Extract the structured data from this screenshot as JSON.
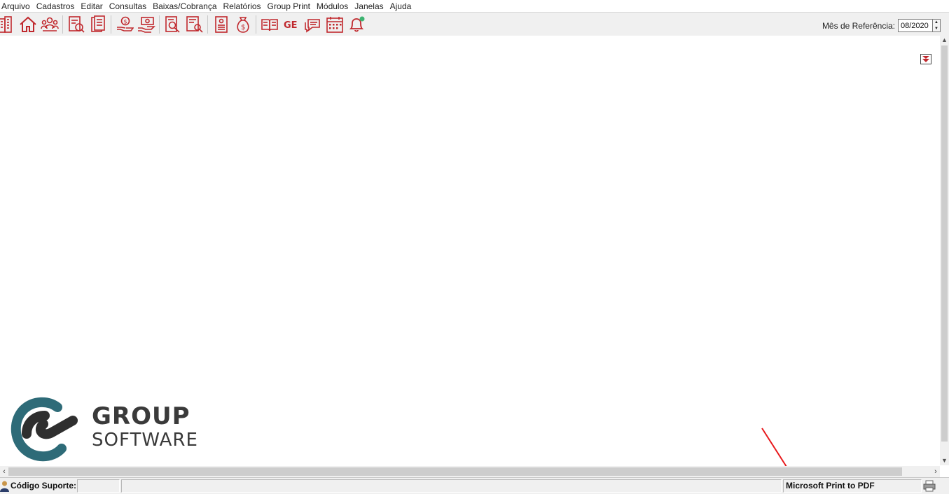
{
  "menu": {
    "items": [
      "Arquivo",
      "Cadastros",
      "Editar",
      "Consultas",
      "Baixas/Cobrança",
      "Relatórios",
      "Group Print",
      "Módulos",
      "Janelas",
      "Ajuda"
    ]
  },
  "toolbar": {
    "icons": [
      "building-icon",
      "home-icon",
      "users-icon",
      "document-search-icon",
      "document-list-icon",
      "coin-hand-icon",
      "money-hand-icon",
      "report-search-icon",
      "report-zoom-icon",
      "receipt-icon",
      "money-bag-icon",
      "book-icon",
      "ge-icon",
      "chat-icon",
      "calendar-icon",
      "bell-icon"
    ],
    "ge_label": "GE",
    "ref_label": "Mês de Referência:",
    "ref_value": "08/2020",
    "accent_color": "#c0282d"
  },
  "logo": {
    "line1": "GROUP",
    "line2": "SOFTWARE",
    "ring_color": "#2e6b78",
    "dark_color": "#2f2f2f"
  },
  "statusbar": {
    "support_label": "Código Suporte:",
    "support_value": "",
    "message": "",
    "printer": "Microsoft Print to PDF"
  },
  "annotation": {
    "arrow_color": "#e8191c"
  }
}
